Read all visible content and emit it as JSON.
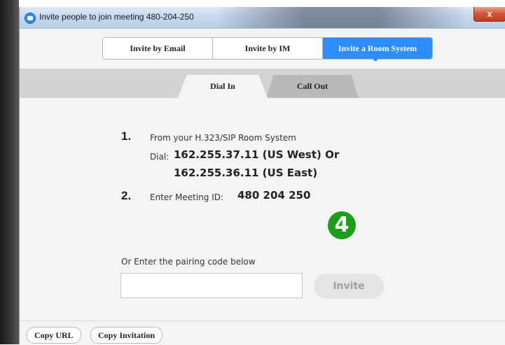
{
  "window": {
    "title": "Invite people to join meeting 480-204-250",
    "close_label": "x"
  },
  "tabs": [
    {
      "label": "Invite by Email",
      "active": false
    },
    {
      "label": "Invite by IM",
      "active": false
    },
    {
      "label": "Invite a Room System",
      "active": true
    }
  ],
  "subtabs": [
    {
      "label": "Dial In",
      "active": true
    },
    {
      "label": "Call Out",
      "active": false
    }
  ],
  "steps": {
    "step1": {
      "number": "1.",
      "text": "From your H.323/SIP Room System",
      "dial_label": "Dial:",
      "dial_line1": "162.255.37.11 (US West) Or",
      "dial_line2": "162.255.36.11 (US East)"
    },
    "step2": {
      "number": "2.",
      "text": "Enter Meeting ID:",
      "meeting_id": "480 204 250"
    }
  },
  "annotation": {
    "badge": "4"
  },
  "pairing": {
    "label": "Or Enter the pairing code below",
    "value": "",
    "placeholder": "",
    "invite_label": "Invite"
  },
  "footer": {
    "copy_url_label": "Copy URL",
    "copy_invitation_label": "Copy Invitation"
  },
  "colors": {
    "accent": "#2d8cff",
    "badge": "#1e9c1e"
  }
}
